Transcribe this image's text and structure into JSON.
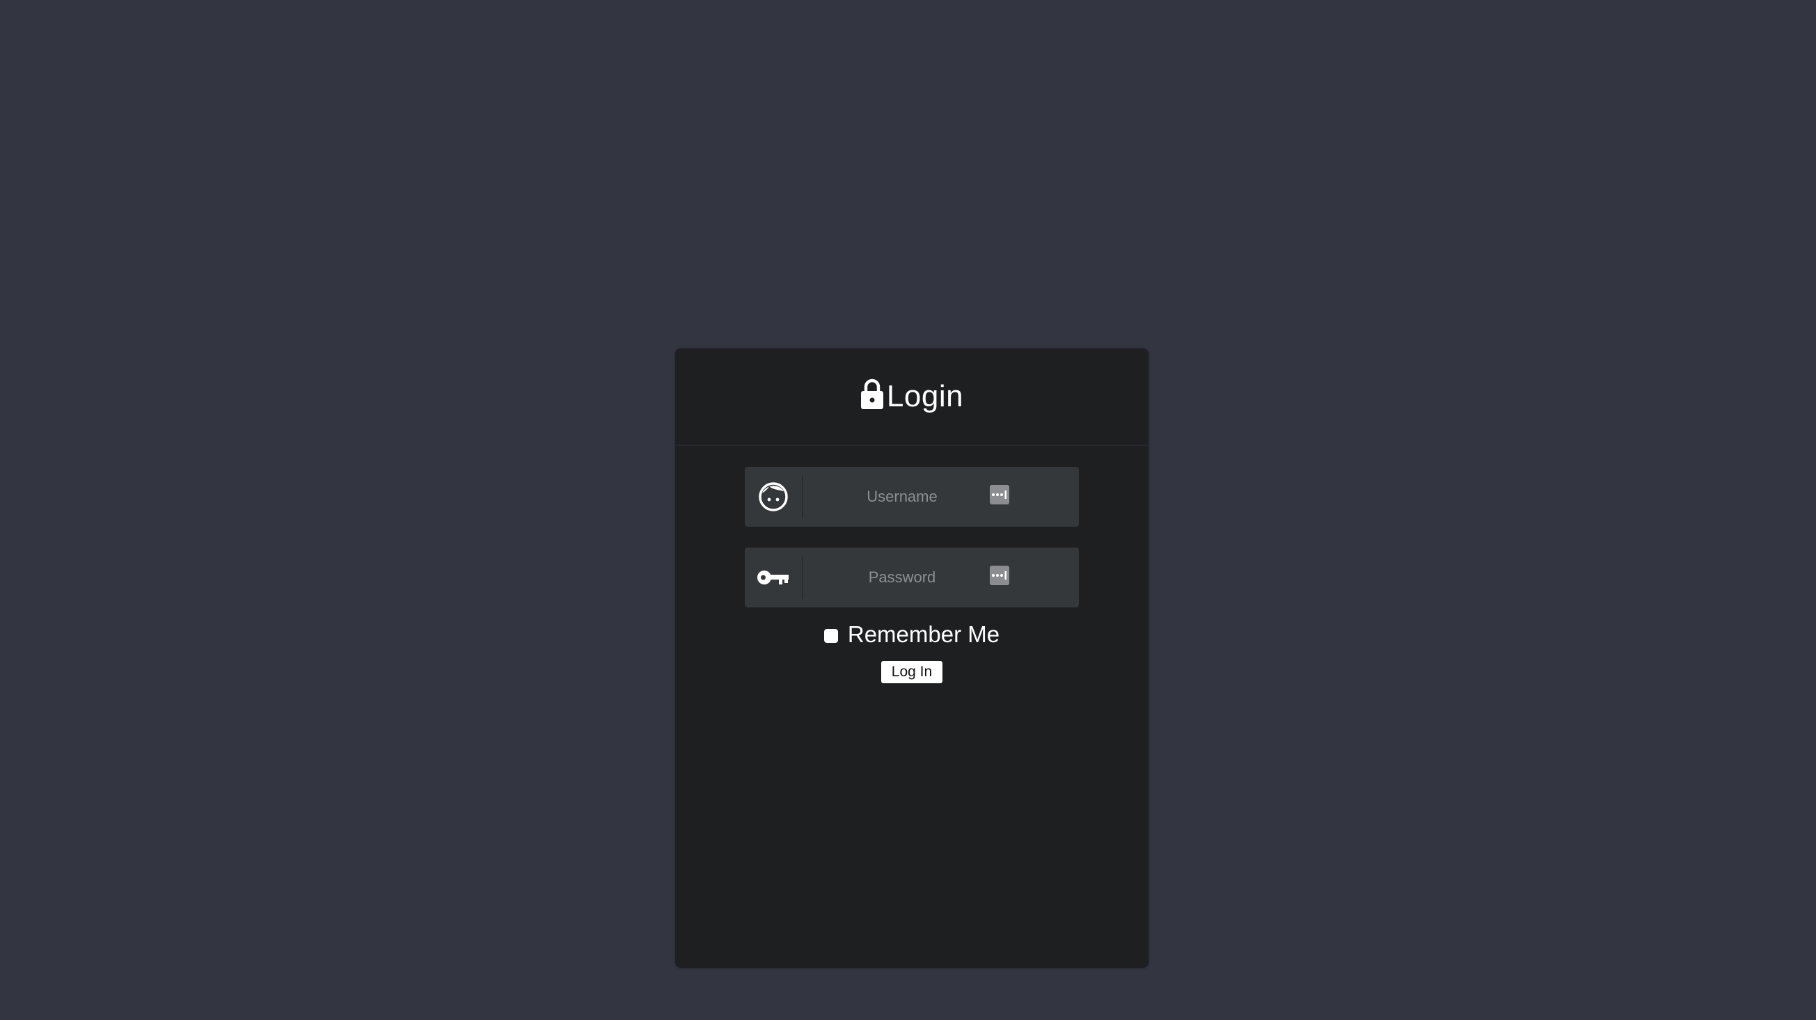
{
  "page": {
    "background_color": "#333641"
  },
  "login_card": {
    "title": "Login",
    "title_icon": "lock-icon",
    "card_color": "#1e1f21",
    "fields": {
      "username": {
        "icon": "face-icon",
        "placeholder": "Username",
        "value": "",
        "autofill_icon": "keychain-icon"
      },
      "password": {
        "icon": "key-icon",
        "placeholder": "Password",
        "value": "",
        "autofill_icon": "keychain-icon"
      }
    },
    "remember_me": {
      "label": "Remember Me",
      "checked": false
    },
    "submit_label": "Log In"
  }
}
